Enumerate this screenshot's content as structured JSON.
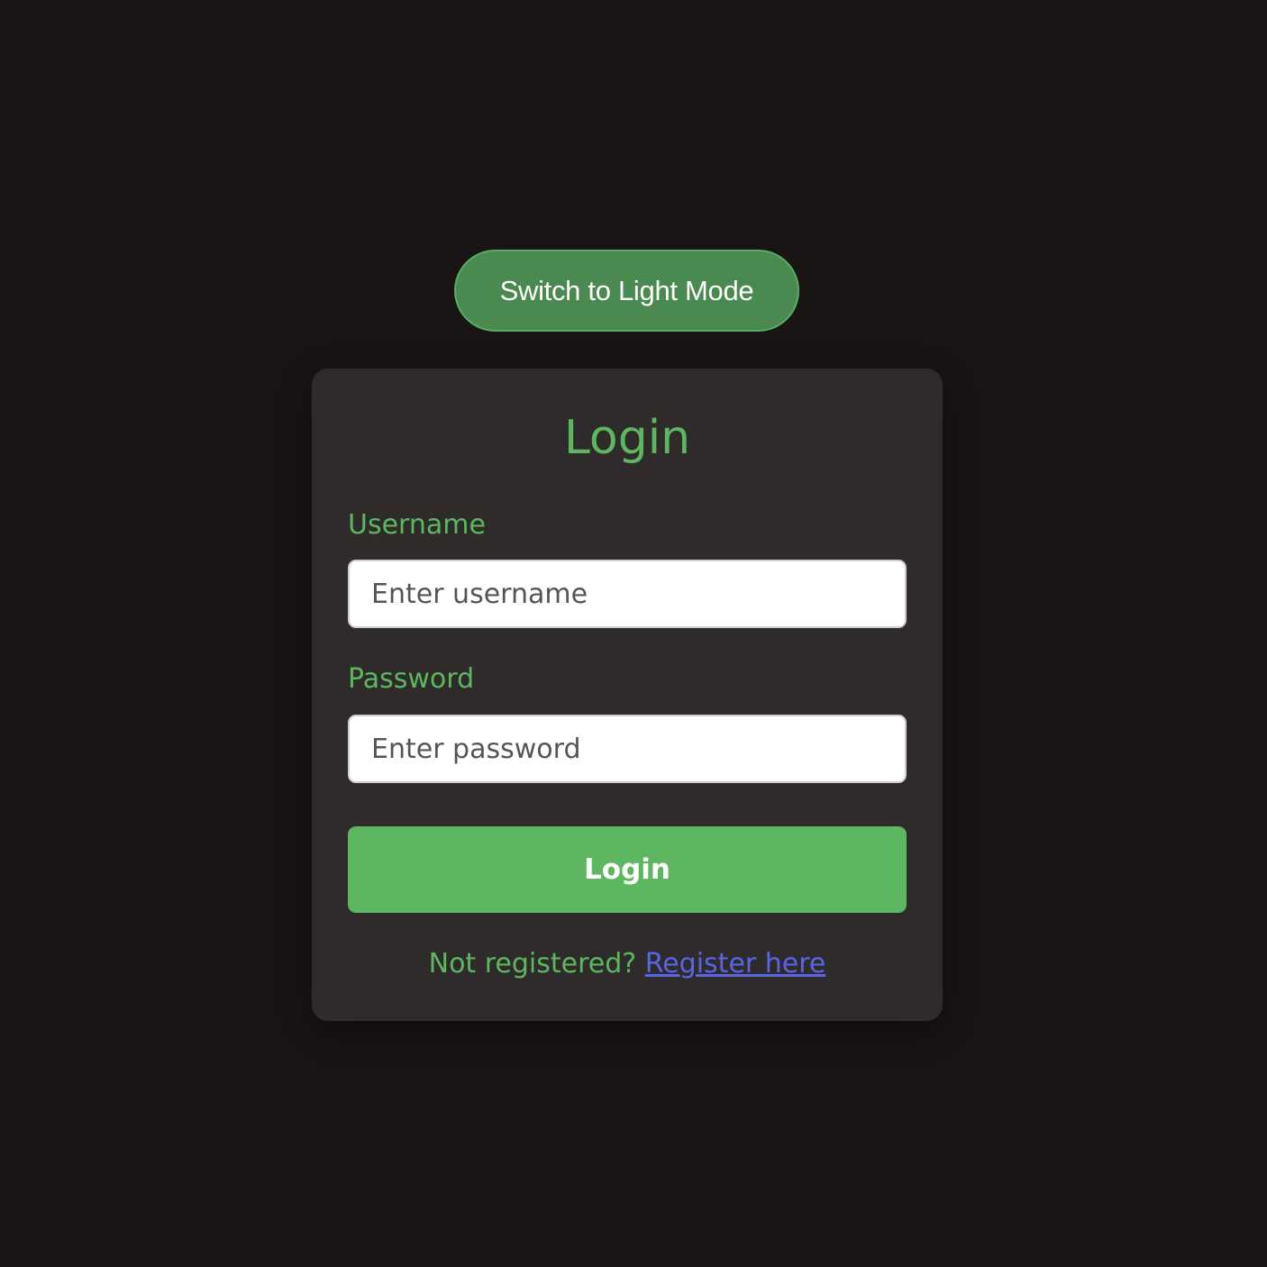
{
  "theme_toggle": {
    "label": "Switch to Light Mode"
  },
  "login_card": {
    "title": "Login",
    "username": {
      "label": "Username",
      "placeholder": "Enter username",
      "value": ""
    },
    "password": {
      "label": "Password",
      "placeholder": "Enter password",
      "value": ""
    },
    "submit_label": "Login",
    "register_prompt": "Not registered?",
    "register_link": "Register here"
  },
  "colors": {
    "background": "#181514",
    "card": "#2f2b2a",
    "accent_green": "#5cb760",
    "toggle_green": "#4a8a50",
    "link_blue": "#5865e6"
  }
}
